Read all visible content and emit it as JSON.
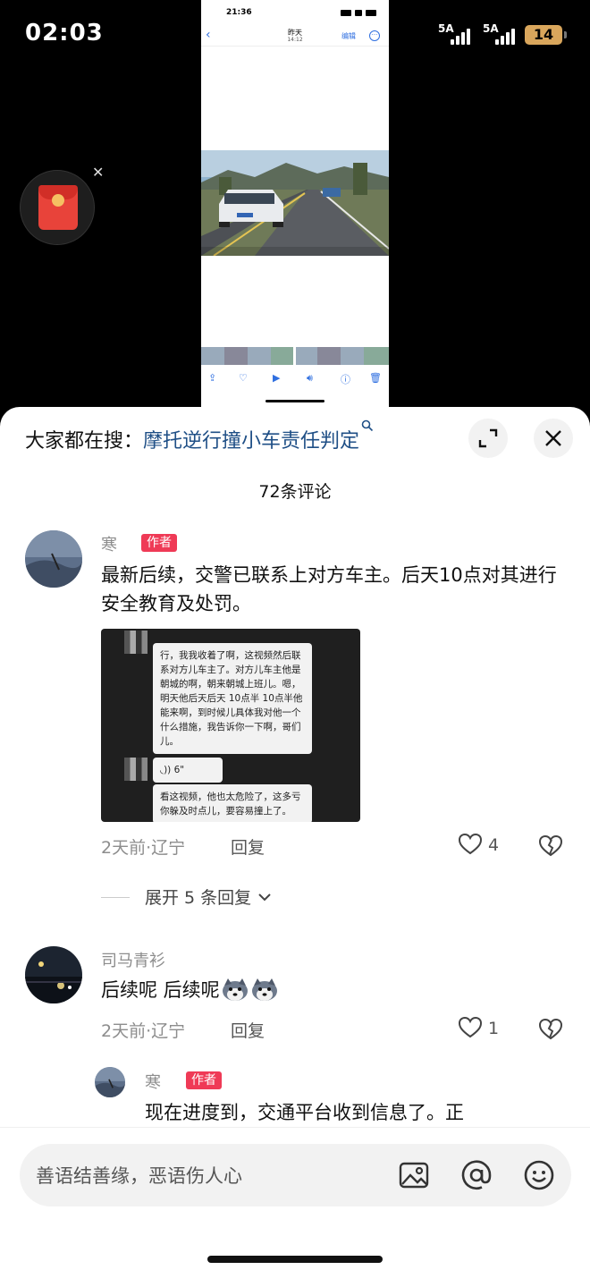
{
  "status_bar": {
    "time": "02:03",
    "signal1": "5A",
    "signal2": "5A",
    "battery": "14"
  },
  "embedded": {
    "time": "21:36",
    "title": "昨天",
    "subtitle": "14:12",
    "edit": "编辑"
  },
  "sheet": {
    "search_prefix": "大家都在搜：",
    "search_keyword": "摩托逆行撞小车责任判定",
    "comment_count": "72条评论"
  },
  "comments": [
    {
      "user": "寒",
      "badge": "作者",
      "text": "最新后续，交警已联系上对方车主。后天10点对其进行安全教育及处罚。",
      "image_msg1": "行，我我收着了啊，这视频然后联系对方儿车主了。对方儿车主他是朝城的啊，朝来朝城上班儿。嗯，明天他后天后天 10点半 10点半他能来啊，到时候儿具体我对他一个什么措施，我告诉你一下啊，哥们儿。",
      "image_voice": "6\"",
      "image_msg2": "看这视频，他也太危险了，这多亏你躲及时点儿，要容易撞上了。",
      "meta": "2天前·辽宁",
      "reply": "回复",
      "likes": "4",
      "expand": "展开 5 条回复"
    },
    {
      "user": "司马青衫",
      "text": "后续呢 后续呢",
      "meta": "2天前·辽宁",
      "reply": "回复",
      "likes": "1"
    },
    {
      "user": "寒",
      "badge": "作者",
      "text": "现在进度到，交通平台收到信息了。正"
    }
  ],
  "composer": {
    "placeholder": "善语结善缘，恶语伤人心"
  }
}
